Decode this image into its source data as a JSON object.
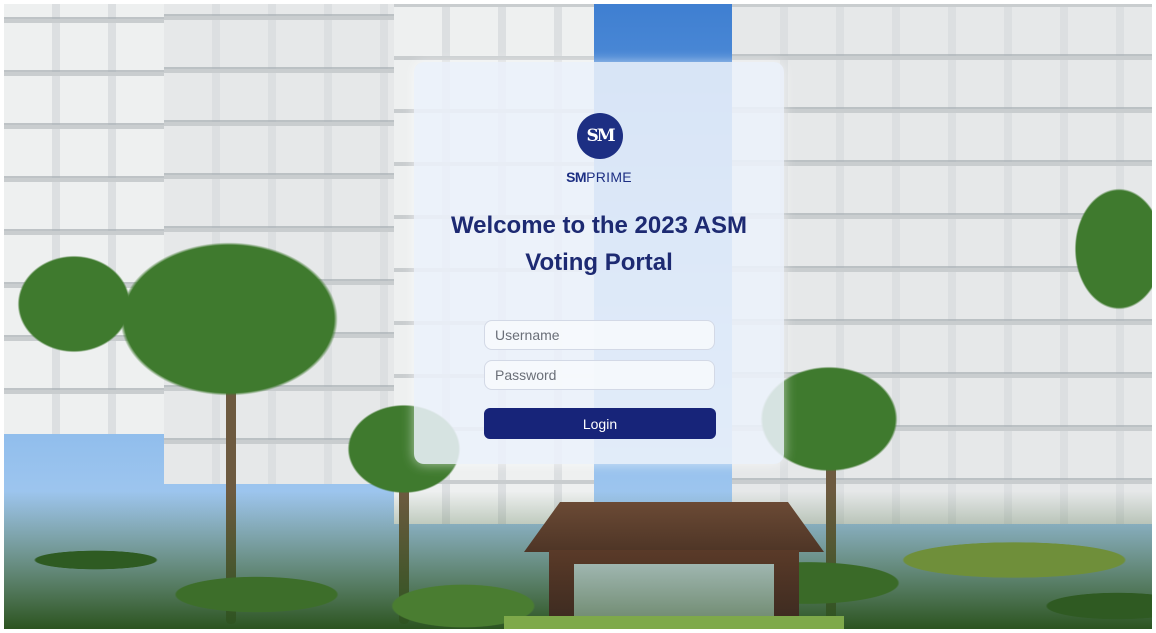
{
  "brand": {
    "logo_monogram": "SM",
    "name_bold": "SM",
    "name_rest": "PRIME",
    "color": "#1d2f83"
  },
  "login": {
    "welcome_line1": "Welcome to the 2023 ASM",
    "welcome_line2": "Voting Portal",
    "username_placeholder": "Username",
    "password_placeholder": "Password",
    "login_label": "Login",
    "button_color": "#172479"
  }
}
